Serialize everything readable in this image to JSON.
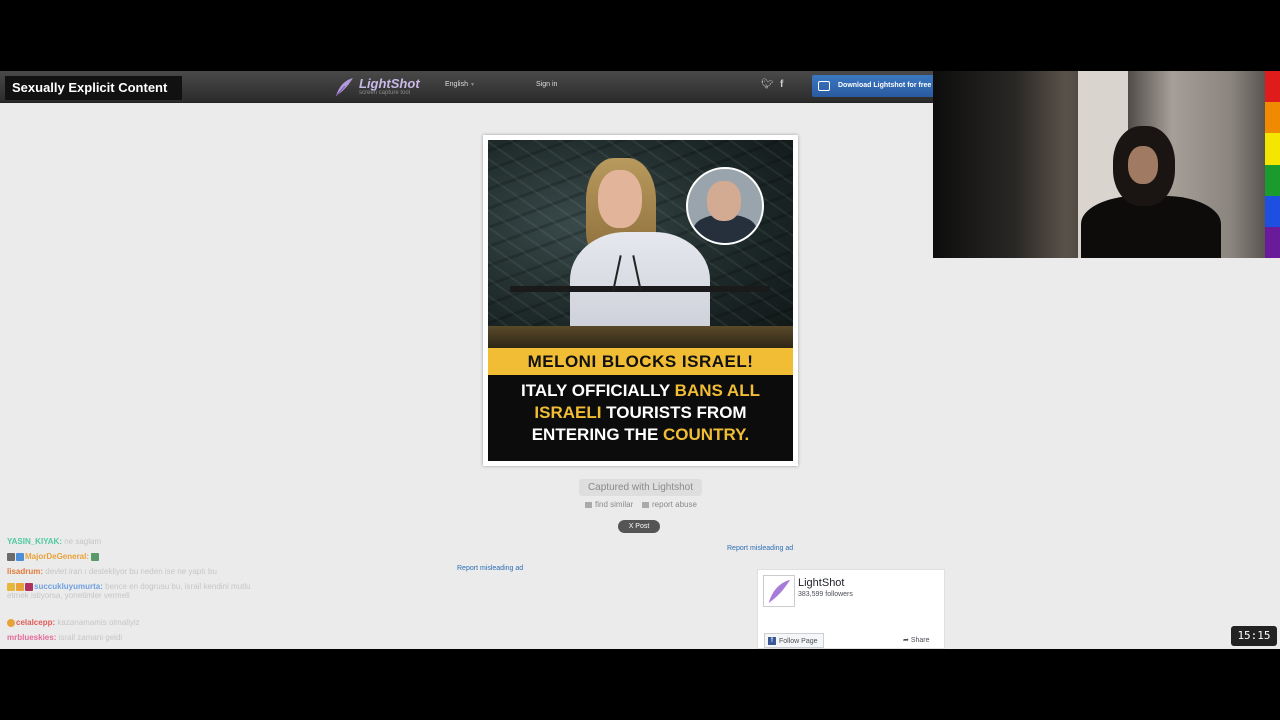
{
  "warning_label": "Sexually Explicit Content",
  "header": {
    "logo_text": "LightShot",
    "logo_sub": "screen capture tool",
    "language": "English",
    "signin": "Sign in",
    "download_label": "Download Lightshot for free"
  },
  "screenshot": {
    "banner": "MELONI BLOCKS ISRAEL!",
    "headline_1a": "ITALY OFFICIALLY ",
    "headline_1b": "BANS ALL",
    "headline_2a": "ISRAELI",
    "headline_2b": " TOURISTS FROM",
    "headline_3a": "ENTERING THE ",
    "headline_3b": "COUNTRY."
  },
  "actions": {
    "captured": "Captured with Lightshot",
    "find_similar": "find similar",
    "report_abuse": "report abuse",
    "post": "X Post",
    "report_ad_1": "Report misleading ad",
    "report_ad_2": "Report misleading ad"
  },
  "facebook": {
    "name": "LightShot",
    "followers": "383,599 followers",
    "follow": "Follow Page",
    "share": "Share"
  },
  "chat": [
    {
      "user": "YASIN_KIYAK:",
      "color": "#4ec9a0",
      "message": "ne saglam"
    },
    {
      "user": "MajorDeGeneral:",
      "color": "#e8a23a",
      "message": ""
    },
    {
      "user": "lisadrum:",
      "color": "#e07b39",
      "message": "devlet iran ı destekliyor bu neden ise ne yaptı bu"
    },
    {
      "user": "succukluyumurta:",
      "color": "#6fa0e0",
      "message": "bence en dogrusu bu, israil kendini mutlu etmek istiyorsa, yonetimler vermeli"
    },
    {
      "user": "celalcepp:",
      "color": "#e05a5a",
      "message": "kazanamamis olmaliyiz"
    },
    {
      "user": "mrblueskies:",
      "color": "#e56a9a",
      "message": "israil zamani geldi"
    }
  ],
  "clock": "15:15",
  "colors": {
    "banner_yellow": "#f0bd35",
    "link_blue": "#2b6fb3",
    "download_blue": "#2a5aa0"
  }
}
